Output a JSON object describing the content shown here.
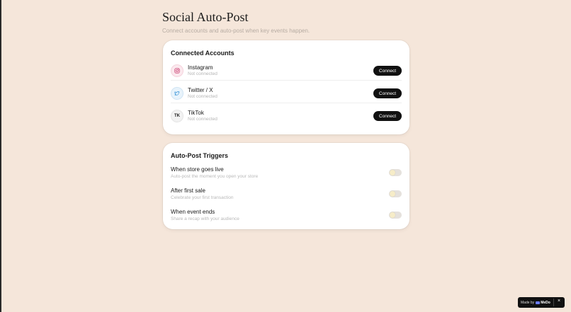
{
  "header": {
    "title": "Social Auto-Post",
    "subtitle": "Connect accounts and auto-post when key events happen."
  },
  "accounts": {
    "title": "Connected Accounts",
    "items": [
      {
        "icon": "instagram-icon",
        "name": "Instagram",
        "status": "Not connected",
        "button": "Connect"
      },
      {
        "icon": "twitter-icon",
        "name": "Twitter / X",
        "status": "Not connected",
        "button": "Connect"
      },
      {
        "icon_text": "TK",
        "name": "TikTok",
        "status": "Not connected",
        "button": "Connect"
      }
    ]
  },
  "triggers": {
    "title": "Auto-Post Triggers",
    "items": [
      {
        "name": "When store goes live",
        "desc": "Auto-post the moment you open your store",
        "enabled": false
      },
      {
        "name": "After first sale",
        "desc": "Celebrate your first transaction",
        "enabled": false
      },
      {
        "name": "When event ends",
        "desc": "Share a recap with your audience",
        "enabled": false
      }
    ]
  },
  "badge": {
    "label": "Made by",
    "brand": "MeDo",
    "close": "×"
  },
  "colors": {
    "background": "#f5e6da",
    "button": "#111111",
    "instagram": "#c83b6e",
    "twitter": "#2f8fd6"
  }
}
